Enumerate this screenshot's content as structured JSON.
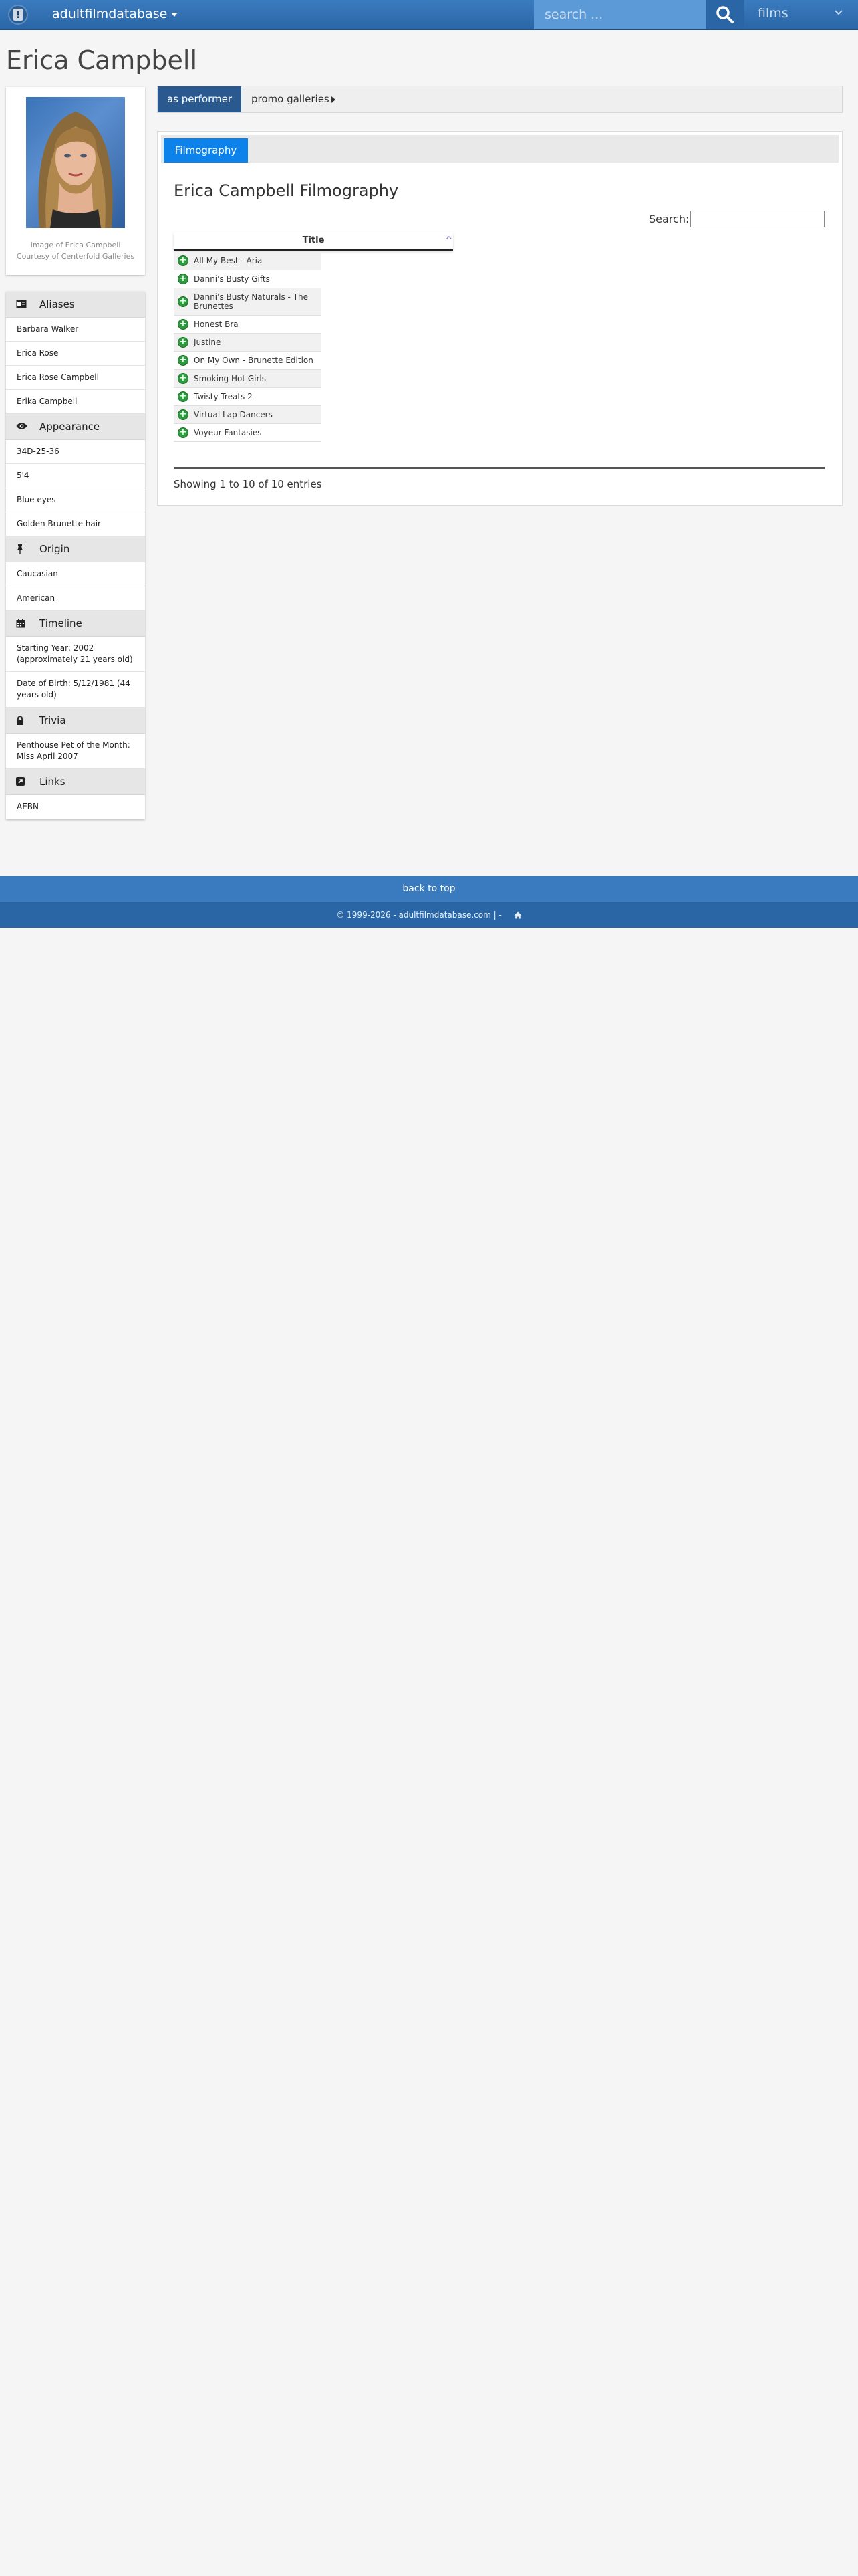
{
  "nav": {
    "brand": "adultfilmdatabase",
    "search_placeholder": "search ...",
    "category": "films"
  },
  "performer": {
    "name": "Erica Campbell",
    "photo_caption_line1": "Image of Erica Campbell",
    "photo_caption_line2": "Courtesy of Centerfold Galleries"
  },
  "sidebar": {
    "sections": [
      {
        "title": "Aliases",
        "icon": "id-card-icon",
        "items": [
          "Barbara Walker",
          "Erica Rose",
          "Erica Rose Campbell",
          "Erika Campbell"
        ]
      },
      {
        "title": "Appearance",
        "icon": "eye-icon",
        "items": [
          "34D-25-36",
          "5'4",
          "Blue eyes",
          "Golden Brunette hair"
        ]
      },
      {
        "title": "Origin",
        "icon": "pin-icon",
        "items": [
          "Caucasian",
          "American"
        ]
      },
      {
        "title": "Timeline",
        "icon": "calendar-icon",
        "items": [
          "Starting Year: 2002 (approximately 21 years old)",
          "Date of Birth: 5/12/1981 (44 years old)"
        ]
      },
      {
        "title": "Trivia",
        "icon": "lock-icon",
        "items": [
          "Penthouse Pet of the Month: Miss April 2007"
        ]
      },
      {
        "title": "Links",
        "icon": "external-link-icon",
        "items": [
          "AEBN"
        ]
      }
    ]
  },
  "pills": {
    "active": "as performer",
    "second": "promo galleries"
  },
  "filmography": {
    "tab": "Filmography",
    "heading": "Erica Campbell Filmography",
    "search_label": "Search:",
    "column_title": "Title",
    "rows": [
      "All My Best - Aria",
      "Danni's Busty Gifts",
      "Danni's Busty Naturals - The Brunettes",
      "Honest Bra",
      "Justine",
      "On My Own - Brunette Edition",
      "Smoking Hot Girls",
      "Twisty Treats 2",
      "Virtual Lap Dancers",
      "Voyeur Fantasies"
    ],
    "info": "Showing 1 to 10 of 10 entries"
  },
  "footer": {
    "back_to_top": "back to top",
    "copyright": "© 1999-2026 - adultfilmdatabase.com | -"
  },
  "colors": {
    "nav_blue": "#2a66a6",
    "active_pill": "#2a5990",
    "active_tab": "#0d82ea",
    "add_green": "#2d9a3e"
  }
}
